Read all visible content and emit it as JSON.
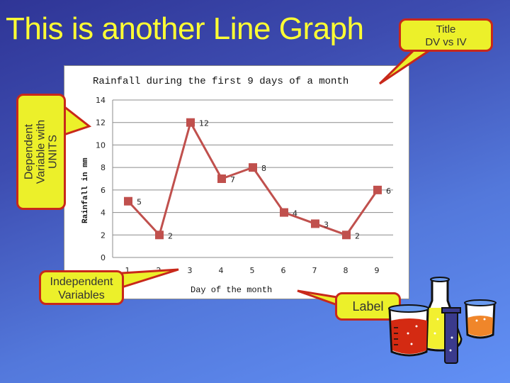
{
  "slide": {
    "title": "This is another Line Graph"
  },
  "callouts": {
    "title_callout": [
      "Title",
      "DV vs IV"
    ],
    "dependent_callout": [
      "Dependent",
      "Variable with",
      "UNITS"
    ],
    "independent_callout": [
      "Independent",
      "Variables"
    ],
    "label_callout": "Label"
  },
  "colors": {
    "title_text": "#ffff33",
    "callout_fill": "#ecf02a",
    "callout_border": "#c8281a",
    "series_line": "#c0504d"
  },
  "chart_data": {
    "type": "line",
    "title": "Rainfall during the first 9 days of a month",
    "xlabel": "Day of the month",
    "ylabel": "Rainfall in mm",
    "x": [
      1,
      2,
      3,
      4,
      5,
      6,
      7,
      8,
      9
    ],
    "categories": [
      "1",
      "2",
      "3",
      "4",
      "5",
      "6",
      "7",
      "8",
      "9"
    ],
    "series": [
      {
        "name": "Rainfall",
        "values": [
          5,
          2,
          12,
          7,
          8,
          4,
          3,
          2,
          6
        ],
        "marker": "square",
        "data_labels": true
      }
    ],
    "ylim": [
      0,
      14
    ],
    "yticks": [
      0,
      2,
      4,
      6,
      8,
      10,
      12,
      14
    ],
    "grid": true,
    "legend": "none"
  }
}
